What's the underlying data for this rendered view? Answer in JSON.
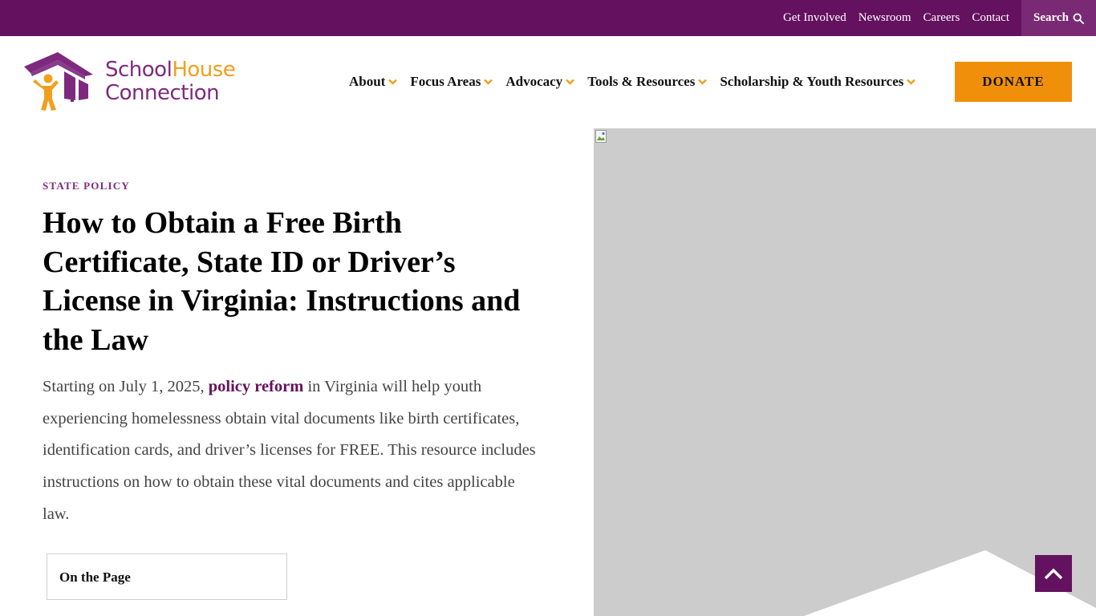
{
  "utility_nav": {
    "links": [
      {
        "label": "Get Involved"
      },
      {
        "label": "Newsroom"
      },
      {
        "label": "Careers"
      },
      {
        "label": "Contact"
      }
    ],
    "search_label": "Search",
    "search_icon": "search-icon"
  },
  "logo": {
    "school": "School",
    "house": "House",
    "connection": "Connection"
  },
  "main_nav": {
    "items": [
      {
        "label": "About"
      },
      {
        "label": "Focus Areas"
      },
      {
        "label": "Advocacy"
      },
      {
        "label": "Tools & Resources"
      },
      {
        "label": "Scholarship & Youth Resources"
      }
    ],
    "chevron_icon": "chevron-down-icon",
    "donate_label": "DONATE"
  },
  "article": {
    "eyebrow": "STATE POLICY",
    "title": "How to Obtain a Free Birth Certificate, State ID or Driver’s License in Virginia: Instructions and the Law",
    "intro_before": "Starting on July 1, 2025, ",
    "intro_link": "policy reform",
    "intro_after": " in Virginia will help youth experiencing homelessness obtain vital documents like birth certificates, identification cards, and driver’s licenses for FREE. This resource includes instructions on how to obtain these vital documents and cites applicable law.",
    "toc_title": "On the Page"
  },
  "colors": {
    "brand_purple": "#64115f",
    "logo_purple": "#7d2a7e",
    "accent_orange": "#f0900a",
    "image_placeholder": "#cccccc"
  },
  "back_to_top_icon": "chevron-up-icon"
}
